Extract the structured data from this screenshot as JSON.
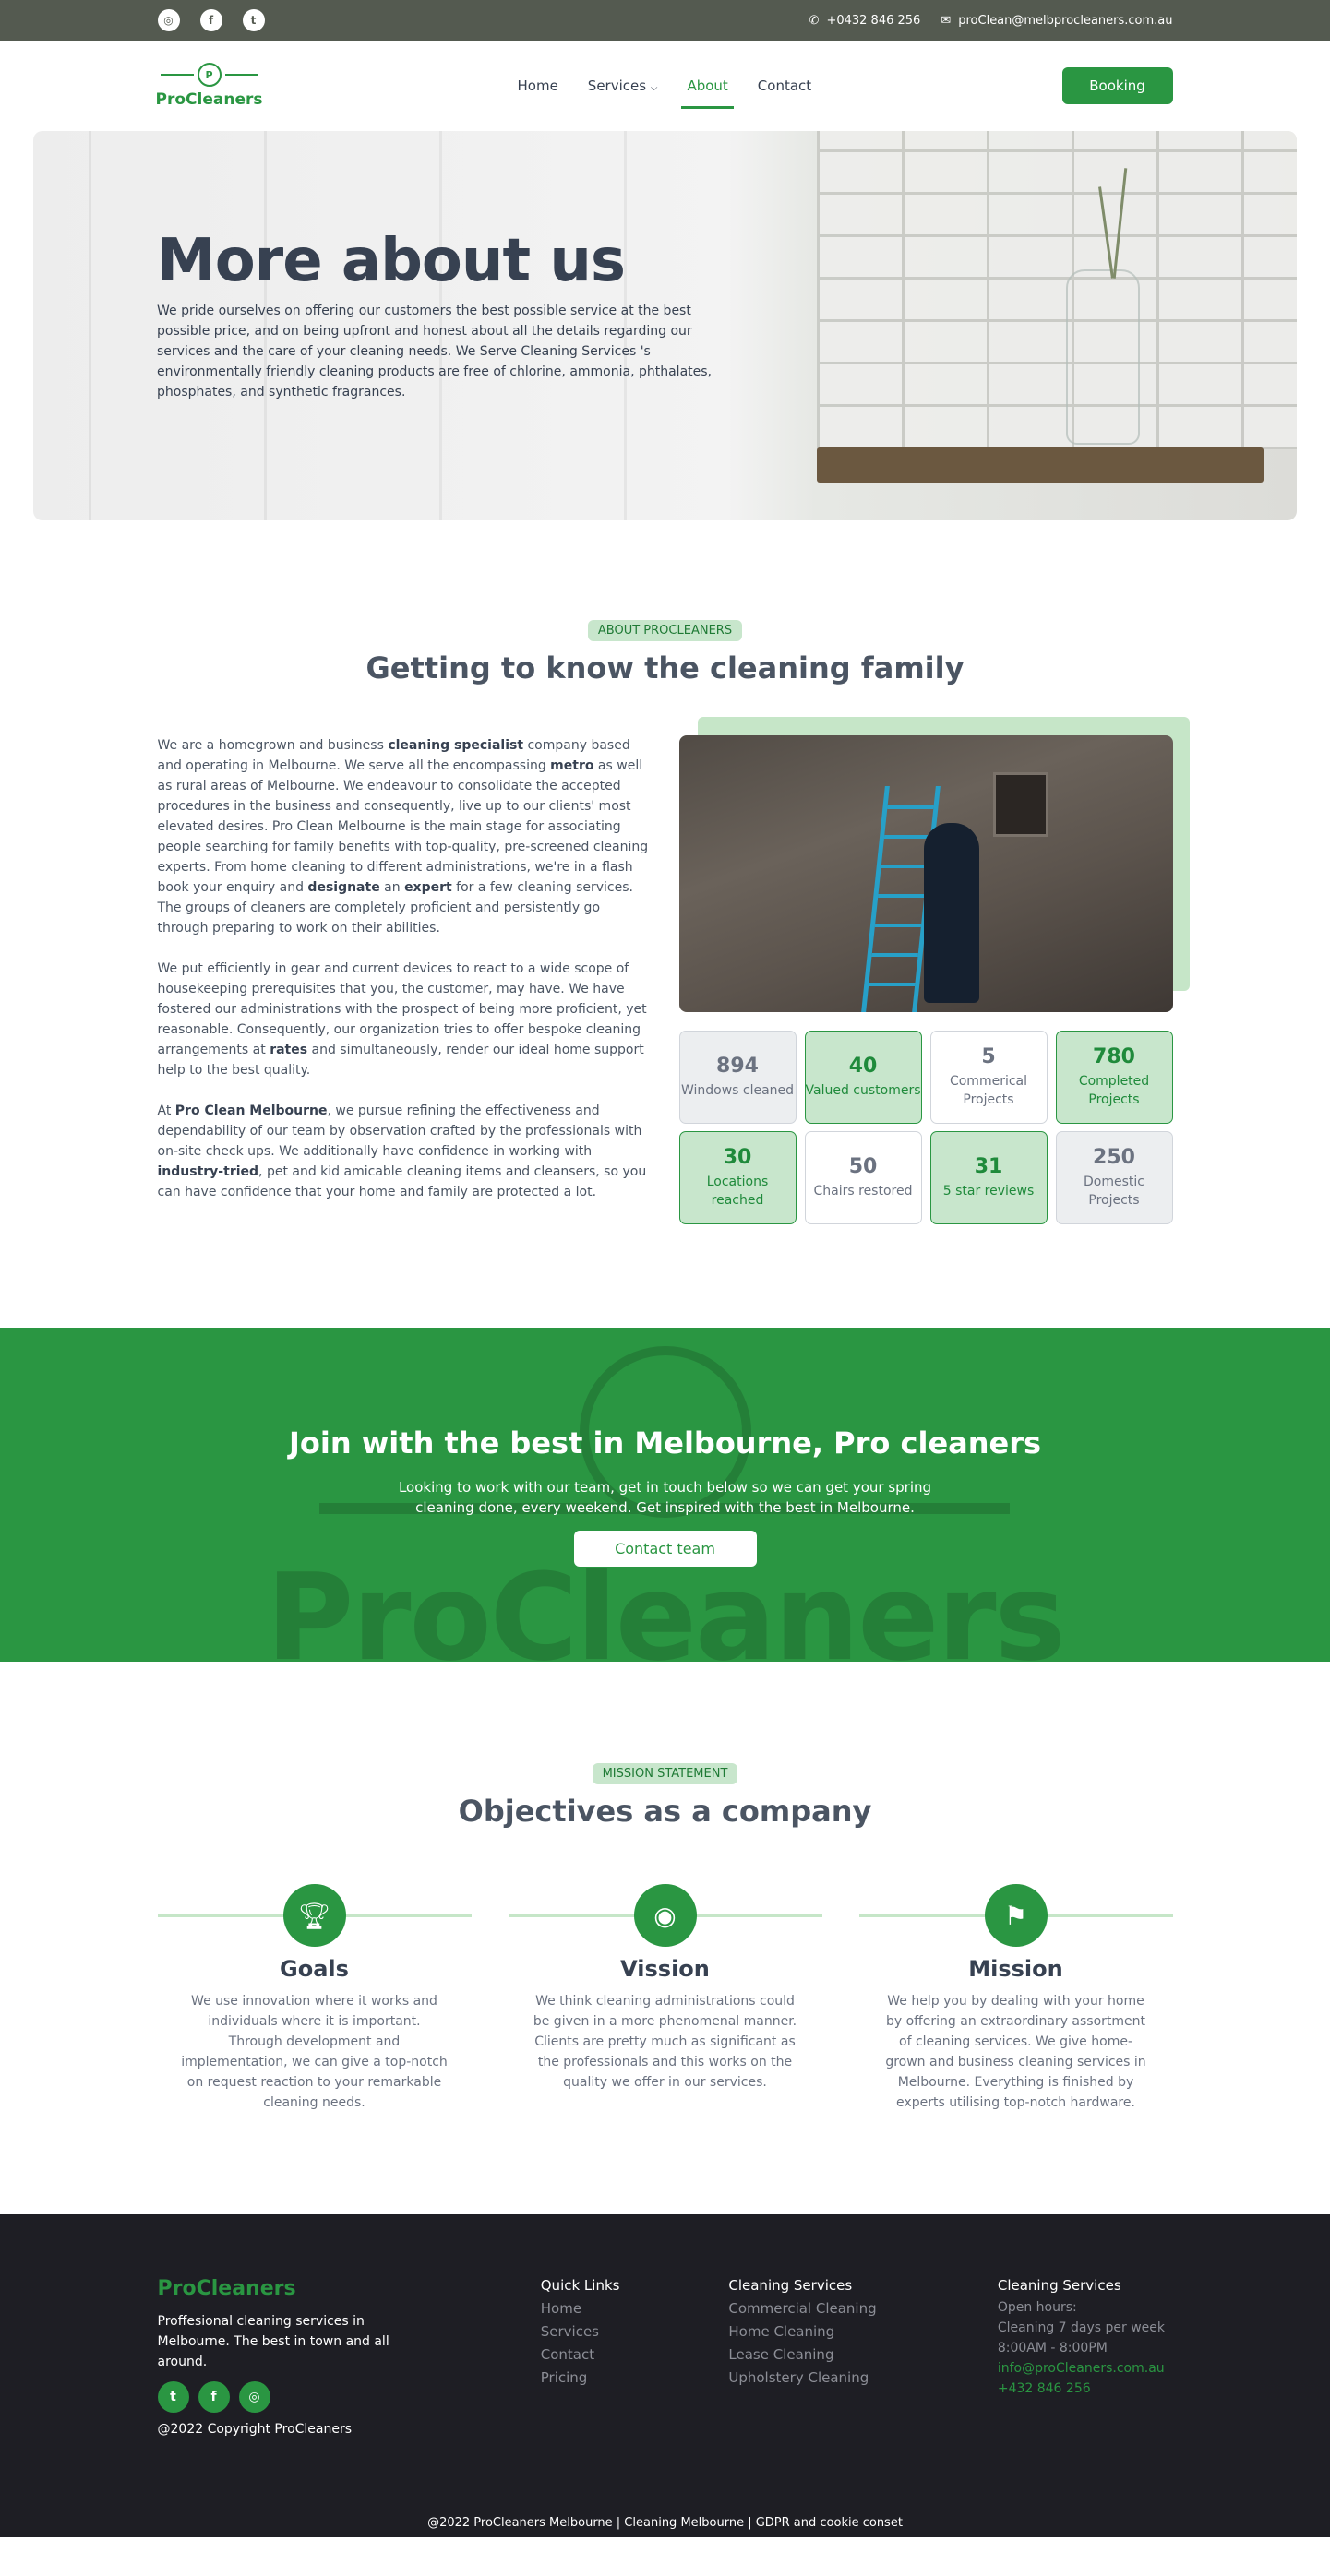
{
  "topbar": {
    "social_icons": [
      "instagram-icon",
      "facebook-icon",
      "twitter-icon"
    ],
    "phone": "+0432 846 256",
    "email": "proClean@melbprocleaners.com.au"
  },
  "nav": {
    "logo_text": "ProCleaners",
    "items": [
      {
        "label": "Home"
      },
      {
        "label": "Services"
      },
      {
        "label": "About"
      },
      {
        "label": "Contact"
      }
    ],
    "active": "About",
    "booking_label": "Booking"
  },
  "hero": {
    "title": "More about us",
    "description": "We pride ourselves on offering our customers the best possible service at the best possible price, and on being upfront and honest about all the details regarding our services and the care of your cleaning needs. We Serve Cleaning Services 's environmentally friendly cleaning products are free of chlorine, ammonia, phthalates, phosphates, and synthetic fragrances."
  },
  "about": {
    "pill": "ABOUT PROCLEANERS",
    "title": "Getting to know the cleaning family",
    "p1": {
      "a": "We are a homegrown and business ",
      "b1": "cleaning specialist",
      "c": " company based and operating in Melbourne. We serve all the encompassing ",
      "b2": "metro",
      "d": " as well as rural areas of Melbourne. We endeavour to consolidate the accepted procedures in the business and consequently, live up to our clients' most elevated desires. Pro Clean Melbourne is the main stage for associating people searching for family benefits with top-quality, pre-screened cleaning experts. From home cleaning to different administrations, we're in a flash book your enquiry and ",
      "b3": "designate",
      "e": " an ",
      "b4": "expert",
      "f": " for a few cleaning services. The groups of cleaners are completely proficient and persistently go through preparing to work on their abilities."
    },
    "p2": {
      "a": "We put efficiently in gear and current devices to react to a wide scope of housekeeping prerequisites that you, the customer, may have. We have fostered our administrations with the prospect of being more proficient, yet reasonable. Consequently, our organization tries to offer bespoke cleaning arrangements at ",
      "b1": "rates",
      "c": " and simultaneously, render our ideal home support help to the best quality."
    },
    "p3": {
      "a": "At ",
      "b1": "Pro Clean Melbourne",
      "c": ", we pursue refining the effectiveness and dependability of our team by observation crafted by the professionals with on-site check ups. We additionally have confidence in working with ",
      "b2": "industry-tried",
      "d": ", pet and kid amicable cleaning items and cleansers, so you can have confidence that your home and family are protected a lot."
    },
    "stats": [
      {
        "num": "894",
        "label": "Windows cleaned",
        "style": "grey"
      },
      {
        "num": "40",
        "label": "Valued customers",
        "style": "green"
      },
      {
        "num": "5",
        "label": "Commerical Projects",
        "style": "white"
      },
      {
        "num": "780",
        "label": "Completed Projects",
        "style": "green"
      },
      {
        "num": "30",
        "label": "Locations reached",
        "style": "green"
      },
      {
        "num": "50",
        "label": "Chairs restored",
        "style": "white"
      },
      {
        "num": "31",
        "label": "5 star reviews",
        "style": "green"
      },
      {
        "num": "250",
        "label": "Domestic Projects",
        "style": "grey"
      }
    ]
  },
  "join": {
    "watermark": "ProCleaners",
    "title": "Join with the best in Melbourne, Pro cleaners",
    "description": "Looking to work with our team, get in touch below so we can get your spring cleaning done, every weekend. Get inspired with the best in Melbourne.",
    "button": "Contact team"
  },
  "mission": {
    "pill": "MISSION STATEMENT",
    "title": "Objectives as a company",
    "items": [
      {
        "icon": "trophy-icon",
        "title": "Goals",
        "desc": "We use innovation where it works and individuals where it is important. Through development and implementation, we can give a top-notch on request reaction to your remarkable cleaning needs."
      },
      {
        "icon": "eye-icon",
        "title": "Vission",
        "desc": "We think cleaning administrations could be given in a more phenomenal manner. Clients are pretty much as significant as the professionals and this works on the quality we offer in our services."
      },
      {
        "icon": "flag-icon",
        "title": "Mission",
        "desc": "We help you by dealing with your home by offering an extraordinary assortment of cleaning services. We give home-grown and business cleaning services in Melbourne. Everything is finished by experts utilising top-notch hardware."
      }
    ]
  },
  "footer": {
    "brand": "ProCleaners",
    "tagline": "Proffesional cleaning services in Melbourne. The best in town and all around.",
    "social_icons": [
      "twitter-icon",
      "facebook-icon",
      "instagram-icon"
    ],
    "copyright": "@2022 Copyright ProCleaners",
    "quick_links": {
      "heading": "Quick Links",
      "items": [
        "Home",
        "Services",
        "Contact",
        "Pricing"
      ]
    },
    "services": {
      "heading": "Cleaning Services",
      "items": [
        "Commercial Cleaning",
        "Home Cleaning",
        "Lease Cleaning",
        "Upholstery Cleaning"
      ]
    },
    "hours": {
      "heading": "Cleaning Services",
      "label": "Open hours:",
      "days": "Cleaning 7 days per week",
      "time": "8:00AM - 8:00PM",
      "email": "info@proCleaners.com.au",
      "phone": "+432 846 256"
    },
    "bottom": "@2022 ProCleaners Melbourne | Cleaning Melbourne | GDPR and cookie conset"
  },
  "colors": {
    "brand_green": "#2a9642",
    "light_green": "#c8e6cc",
    "topbar": "#545a50",
    "footer_bg": "#1e1e24"
  }
}
